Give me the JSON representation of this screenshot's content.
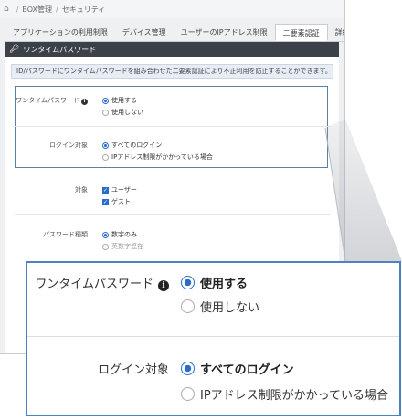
{
  "breadcrumb": {
    "items": [
      "BOX管理",
      "セキュリティ"
    ]
  },
  "tabs": [
    {
      "label": "アプリケーションの利用制限",
      "active": false
    },
    {
      "label": "デバイス管理",
      "active": false
    },
    {
      "label": "ユーザーのIPアドレス制限",
      "active": false
    },
    {
      "label": "二要素認証",
      "active": true
    },
    {
      "label": "詳細設",
      "active": false
    }
  ],
  "section": {
    "title": "ワンタイムパスワード",
    "info_text": "ID/パスワードにワンタイムパスワードを組み合わせた二要素認証により不正利用を防止することができます。"
  },
  "settings": {
    "otp": {
      "label": "ワンタイムパスワード",
      "options": [
        "使用する",
        "使用しない"
      ],
      "selected": 0
    },
    "login_target": {
      "label": "ログイン対象",
      "options": [
        "すべてのログイン",
        "IPアドレス制限がかかっている場合"
      ],
      "selected": 0
    },
    "target": {
      "label": "対象",
      "options": [
        "ユーザー",
        "ゲスト"
      ]
    },
    "password_type": {
      "label": "パスワード種類",
      "options": [
        "数字のみ",
        "英数字混在"
      ],
      "selected": 0
    }
  },
  "colors": {
    "accent": "#2a6cc9",
    "callout_border": "#4d82c2",
    "section_bar": "#3b4049"
  },
  "icons": {
    "home": "home-icon",
    "key": "key-icon",
    "info": "info-icon"
  }
}
